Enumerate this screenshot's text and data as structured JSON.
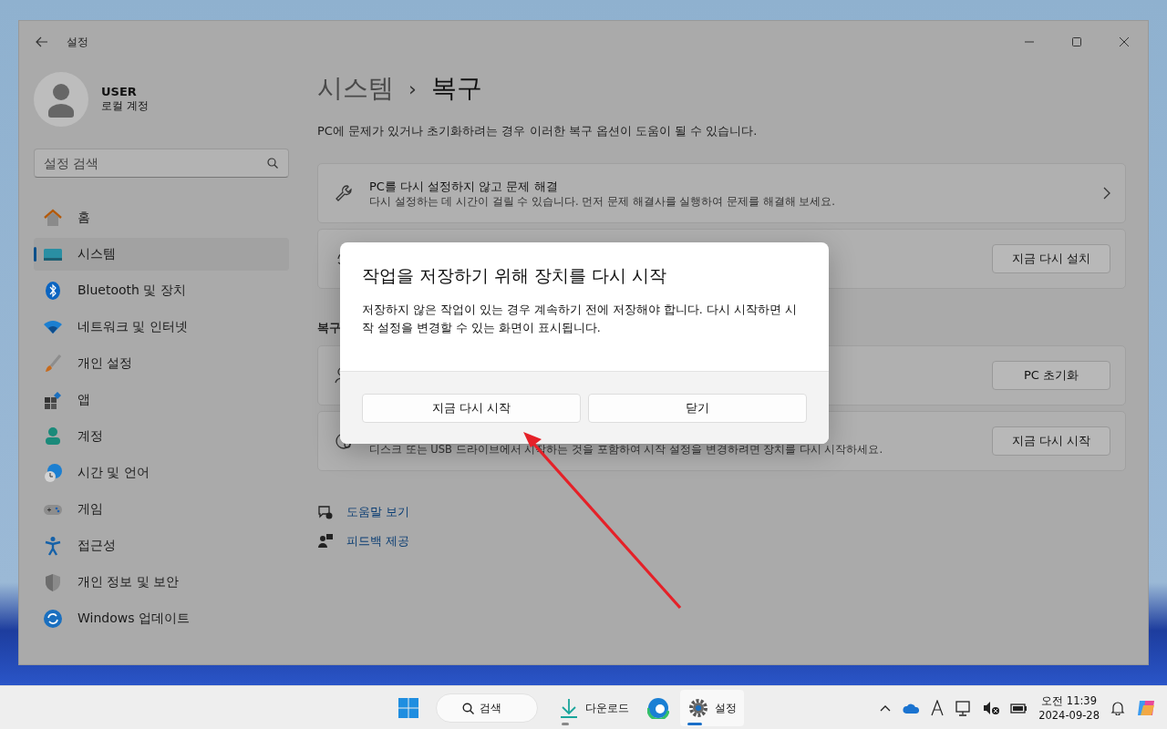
{
  "window": {
    "title": "설정"
  },
  "account": {
    "name": "USER",
    "type": "로컬 계정"
  },
  "search": {
    "placeholder": "설정 검색"
  },
  "sidebar": {
    "items": [
      {
        "label": "홈",
        "selected": false
      },
      {
        "label": "시스템",
        "selected": true
      },
      {
        "label": "Bluetooth 및 장치",
        "selected": false
      },
      {
        "label": "네트워크 및 인터넷",
        "selected": false
      },
      {
        "label": "개인 설정",
        "selected": false
      },
      {
        "label": "앱",
        "selected": false
      },
      {
        "label": "계정",
        "selected": false
      },
      {
        "label": "시간 및 언어",
        "selected": false
      },
      {
        "label": "게임",
        "selected": false
      },
      {
        "label": "접근성",
        "selected": false
      },
      {
        "label": "개인 정보 및 보안",
        "selected": false
      },
      {
        "label": "Windows 업데이트",
        "selected": false
      }
    ]
  },
  "page": {
    "breadcrumb": [
      "시스템",
      "›",
      "복구"
    ],
    "description": "PC에 문제가 있거나 초기화하려는 경우 이러한 복구 옵션이 도움이 될 수 있습니다.",
    "blocks": [
      {
        "kind": "card",
        "title": "PC를 다시 설정하지 않고 문제 해결",
        "subtitle": "다시 설정하는 데 시간이 걸릴 수 있습니다. 먼저 문제 해결사를 실행하여 문제를 해결해 보세요."
      },
      {
        "kind": "card",
        "button": "지금 다시 설치"
      },
      {
        "kind": "header",
        "title": "복구"
      },
      {
        "kind": "card",
        "button": "PC 초기화"
      },
      {
        "kind": "card",
        "subtitle": "디스크 또는 USB 드라이브에서 시작하는 것을 포함하여 시작 설정을 변경하려면 장치를 다시 시작하세요.",
        "button": "지금 다시 시작"
      }
    ],
    "links": [
      "도움말 보기",
      "피드백 제공"
    ]
  },
  "dialog": {
    "title": "작업을 저장하기 위해 장치를 다시 시작",
    "body": "저장하지 않은 작업이 있는 경우 계속하기 전에 저장해야 합니다. 다시 시작하면 시작 설정을 변경할 수 있는 화면이 표시됩니다.",
    "buttons": [
      "지금 다시 시작",
      "닫기"
    ]
  },
  "taskbar": {
    "search": "검색",
    "apps": [
      {
        "label": "다운로드",
        "active": false
      },
      {
        "label": "설정",
        "active": true
      }
    ],
    "time": "오전 11:39",
    "date": "2024-09-28"
  }
}
